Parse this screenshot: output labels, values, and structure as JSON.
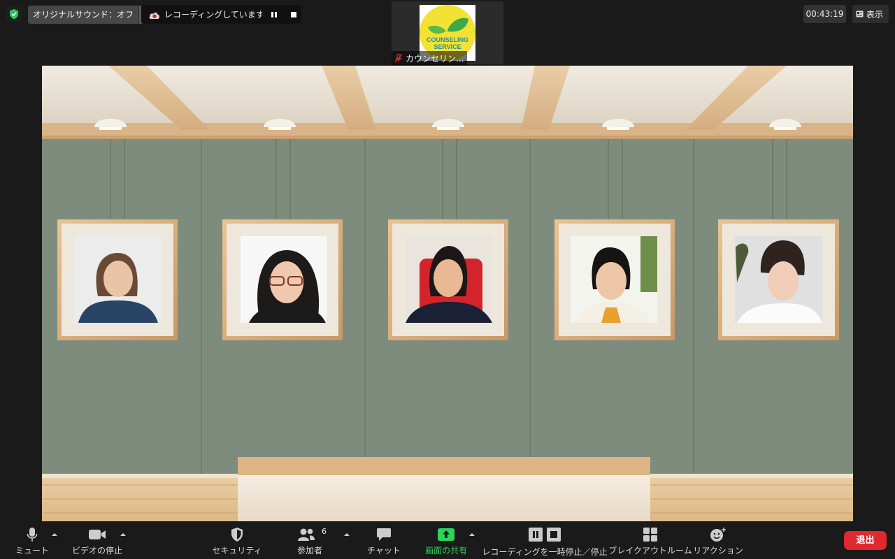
{
  "topbar": {
    "security_icon": "shield-check-icon",
    "original_sound_label": "オリジナルサウンド：オフ",
    "recording_text": "レコーディングしています...",
    "timer": "00:43:19",
    "view_label": "表示"
  },
  "thumbnail": {
    "logo_text_1": "COUNSELING",
    "logo_text_2": "SERVICE",
    "name": "カウンセリン..."
  },
  "stage": {
    "participants": [
      "participant-1",
      "participant-2",
      "participant-3",
      "participant-4",
      "participant-5"
    ]
  },
  "toolbar": {
    "mute_label": "ミュート",
    "video_label": "ビデオの停止",
    "security_label": "セキュリティ",
    "participants_label": "参加者",
    "participants_count": "6",
    "chat_label": "チャット",
    "share_label": "画面の共有",
    "record_label": "レコーディングを一時停止／停止",
    "breakout_label": "ブレイクアウトルーム",
    "reactions_label": "リアクション",
    "leave_label": "退出"
  },
  "colors": {
    "share_green": "#2dd35a",
    "leave_red": "#e0282e",
    "wall": "#7c8b7b"
  }
}
